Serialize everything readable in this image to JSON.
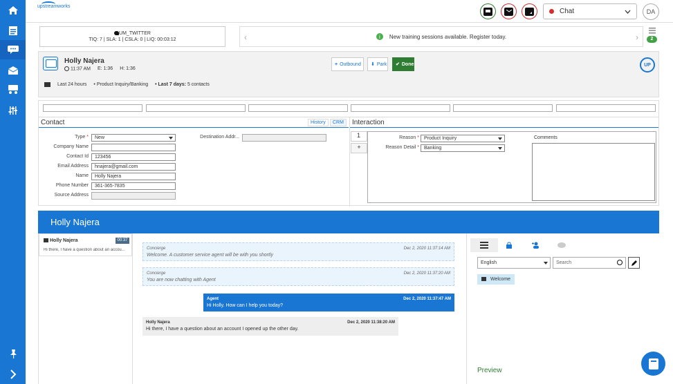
{
  "app": {
    "logo_text": "upstreamworks"
  },
  "leftnav": {
    "items": [
      {
        "name": "home-icon"
      },
      {
        "name": "clipboard-icon"
      },
      {
        "name": "chat-icon"
      },
      {
        "name": "mail-icon"
      },
      {
        "name": "team-icon"
      },
      {
        "name": "sliders-icon"
      },
      {
        "name": "pin-icon"
      },
      {
        "name": "chevron-right-icon"
      }
    ]
  },
  "topbar": {
    "channel_select": "Chat",
    "user_initials": "DA",
    "colors": {
      "chat": "#2e7d32",
      "email": "#d32f2f",
      "note": "#d32f2f"
    }
  },
  "stats": {
    "queue_name": "UM_TWITTER",
    "line": "TIQ: 7 | SLA: 1 | CSLA: 0 | LIQ: 00:03:12"
  },
  "notification": {
    "text": "New training sessions available. Register today.",
    "badge": "2"
  },
  "customer": {
    "name": "Holly Najera",
    "time": "11:37 AM",
    "e": "E: 1:36",
    "h": "H: 1:36",
    "last24": "Last 24 hours",
    "category": "• Product Inquiry/Banking",
    "last7_label": "• Last 7 days:",
    "last7_value": "5 contacts"
  },
  "actions": {
    "outbound": "Outbound",
    "park": "Park",
    "done": "Done"
  },
  "contact": {
    "title": "Contact",
    "history_tab": "History",
    "crm_tab": "CRM",
    "fields": [
      {
        "label": "Type",
        "required": "*",
        "value": "New"
      },
      {
        "label": "Company Name",
        "required": "",
        "value": ""
      },
      {
        "label": "Contact Id",
        "required": "",
        "value": "123456"
      },
      {
        "label": "Email Address",
        "required": "",
        "value": "hnajera@gmail.com"
      },
      {
        "label": "Name",
        "required": "",
        "value": "Holly Najera"
      },
      {
        "label": "Phone Number",
        "required": "",
        "value": "361-365-7835"
      },
      {
        "label": "Source Address",
        "required": "",
        "value": ""
      }
    ],
    "dest_label": "Destination Addr..."
  },
  "interaction": {
    "title": "Interaction",
    "index": "1",
    "add": "+",
    "reason_label": "Reason",
    "reason_value": "Product Inquiry",
    "detail_label": "Reason Detail",
    "detail_value": "Banking",
    "comments_label": "Comments",
    "required": "*"
  },
  "chat": {
    "title": "Holly Najera",
    "queue_item": {
      "name": "Holly Najera",
      "timer": "00:37",
      "preview": "Hi there, I have a question about an accou..."
    },
    "messages": [
      {
        "from": "Concierge",
        "time": "Dec 2, 2020 11:37:14 AM",
        "text": "Welcome. A customer service agent will be with you shortly"
      },
      {
        "from": "Concierge",
        "time": "Dec 2, 2020 11:37:20 AM",
        "text": "You are now chatting with Agent"
      },
      {
        "from": "Agent",
        "time": "Dec 2, 2020 11:37:47 AM",
        "text": "Hi Holly. How can I help you today?"
      },
      {
        "from": "Holly Najera",
        "time": "Dec 2, 2020 11:38:20 AM",
        "text": "Hi there, I have a question about an account I opened up the other day."
      }
    ]
  },
  "kb": {
    "language": "English",
    "search_placeholder": "Search",
    "folder": "Welcome",
    "preview": "Preview"
  }
}
